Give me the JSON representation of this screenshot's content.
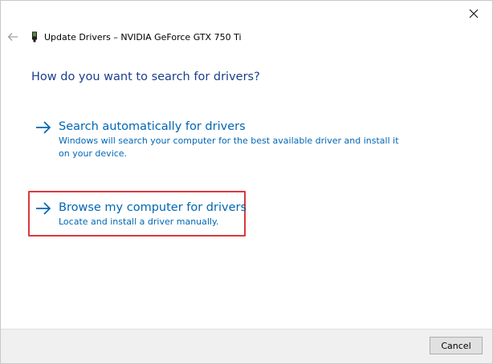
{
  "window": {
    "close_label": "✕",
    "back_label": "←"
  },
  "header": {
    "title": "Update Drivers – NVIDIA GeForce GTX 750 Ti"
  },
  "question": "How do you want to search for drivers?",
  "options": [
    {
      "title": "Search automatically for drivers",
      "description": "Windows will search your computer for the best available driver and install it on your device."
    },
    {
      "title": "Browse my computer for drivers",
      "description": "Locate and install a driver manually."
    }
  ],
  "footer": {
    "cancel_label": "Cancel"
  },
  "colors": {
    "accent_blue": "#0066b4",
    "heading_blue": "#1a3f8c",
    "highlight_red": "#d9393d"
  }
}
